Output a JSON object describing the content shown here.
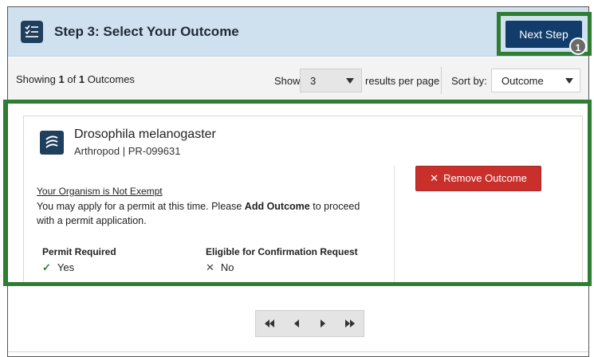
{
  "header": {
    "step_title": "Step 3: Select Your Outcome",
    "next_button": "Next Step",
    "badge_count": "1",
    "icon": "checklist-icon"
  },
  "toolbar": {
    "showing_prefix": "Showing",
    "showing_current": "1",
    "showing_of": "of",
    "showing_total": "1",
    "showing_suffix": "Outcomes",
    "show_label": "Show",
    "per_page_value": "3",
    "results_label": "results per page",
    "sort_label": "Sort by:",
    "sort_value": "Outcome"
  },
  "outcome": {
    "icon": "organism-icon",
    "name": "Drosophila melanogaster",
    "subtitle": "Arthropod | PR-099631",
    "exempt_status": "Your Organism is Not Exempt",
    "apply_text_before": "You may apply for a permit at this time. Please",
    "apply_text_bold": "Add Outcome",
    "apply_text_after": "to proceed with a permit application.",
    "permit_required_label": "Permit Required",
    "permit_required_value": "Yes",
    "confirmation_label": "Eligible for Confirmation Request",
    "confirmation_value": "No",
    "remove_button": "Remove Outcome"
  },
  "pagination": {
    "first": "first-page-icon",
    "prev": "previous-page-icon",
    "next": "next-page-icon",
    "last": "last-page-icon"
  },
  "colors": {
    "header_bg": "#cfe1ee",
    "primary": "#123c69",
    "danger": "#c9302c",
    "highlight": "#2e7d32"
  }
}
